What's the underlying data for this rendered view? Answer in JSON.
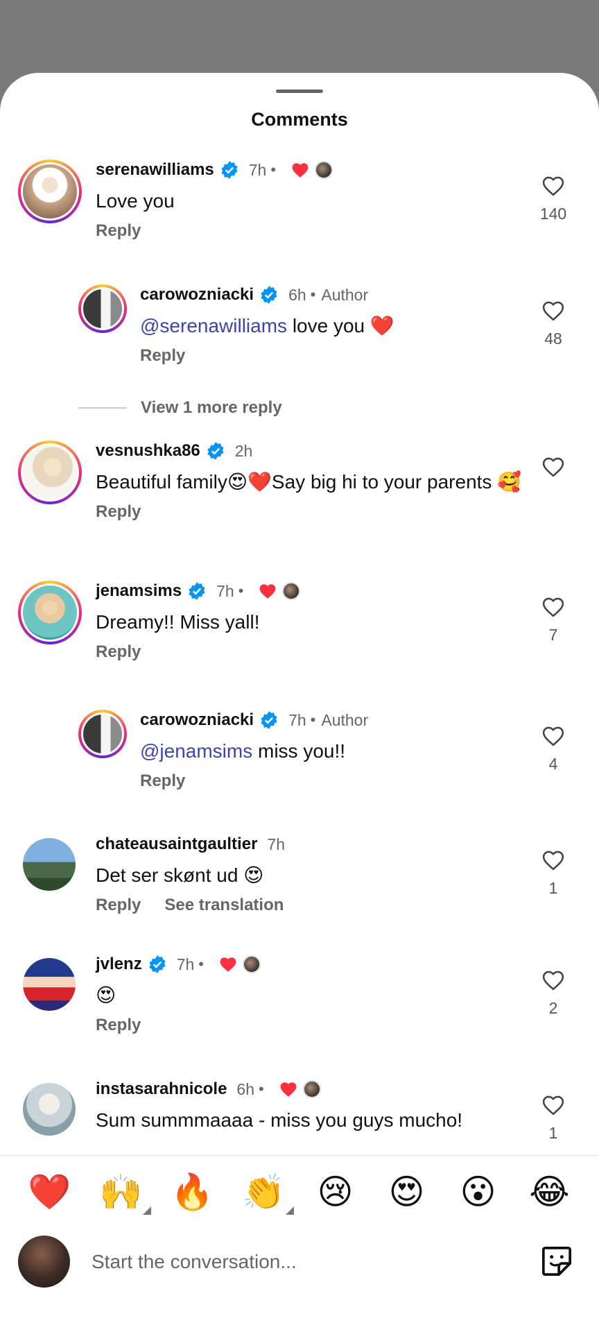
{
  "sheet": {
    "title": "Comments"
  },
  "comments": [
    {
      "username": "serenawilliams",
      "verified": true,
      "time": "7h",
      "author": "",
      "liked_by_author": true,
      "text": "Love you",
      "mention": "",
      "likes": "140",
      "actions": [
        "Reply"
      ]
    },
    {
      "username": "carowozniacki",
      "verified": true,
      "time": "6h",
      "author": "Author",
      "liked_by_author": false,
      "mention": "@serenawilliams",
      "text": " love you ❤️",
      "likes": "48",
      "actions": [
        "Reply"
      ]
    },
    {
      "username": "vesnushka86",
      "verified": true,
      "time": "2h",
      "author": "",
      "liked_by_author": false,
      "mention": "",
      "text": "Beautiful family😍❤️Say big hi to your parents 🥰",
      "likes": "",
      "actions": [
        "Reply"
      ]
    },
    {
      "username": "jenamsims",
      "verified": true,
      "time": "7h",
      "author": "",
      "liked_by_author": true,
      "mention": "",
      "text": "Dreamy!! Miss yall!",
      "likes": "7",
      "actions": [
        "Reply"
      ]
    },
    {
      "username": "carowozniacki",
      "verified": true,
      "time": "7h",
      "author": "Author",
      "liked_by_author": false,
      "mention": "@jenamsims",
      "text": " miss you!!",
      "likes": "4",
      "actions": [
        "Reply"
      ]
    },
    {
      "username": "chateausaintgaultier",
      "verified": false,
      "time": "7h",
      "author": "",
      "liked_by_author": false,
      "mention": "",
      "text": "Det ser skønt ud 😍",
      "likes": "1",
      "actions": [
        "Reply",
        "See translation"
      ]
    },
    {
      "username": "jvlenz",
      "verified": true,
      "time": "7h",
      "author": "",
      "liked_by_author": true,
      "mention": "",
      "text": "😍",
      "likes": "2",
      "actions": [
        "Reply"
      ]
    },
    {
      "username": "instasarahnicole",
      "verified": false,
      "time": "6h",
      "author": "",
      "liked_by_author": true,
      "mention": "",
      "text": "Sum summmaaaa - miss you guys mucho!",
      "likes": "1",
      "actions": []
    }
  ],
  "view_more": "View 1 more reply",
  "separator": "•",
  "reactions": [
    "❤️",
    "🙌",
    "🔥",
    "👏",
    "😢",
    "😍",
    "😮",
    "😂"
  ],
  "composer": {
    "placeholder": "Start the conversation..."
  },
  "colors": {
    "accent_blue": "#0095f6",
    "heart_red": "#ff3040",
    "mention": "#3d45a8"
  }
}
